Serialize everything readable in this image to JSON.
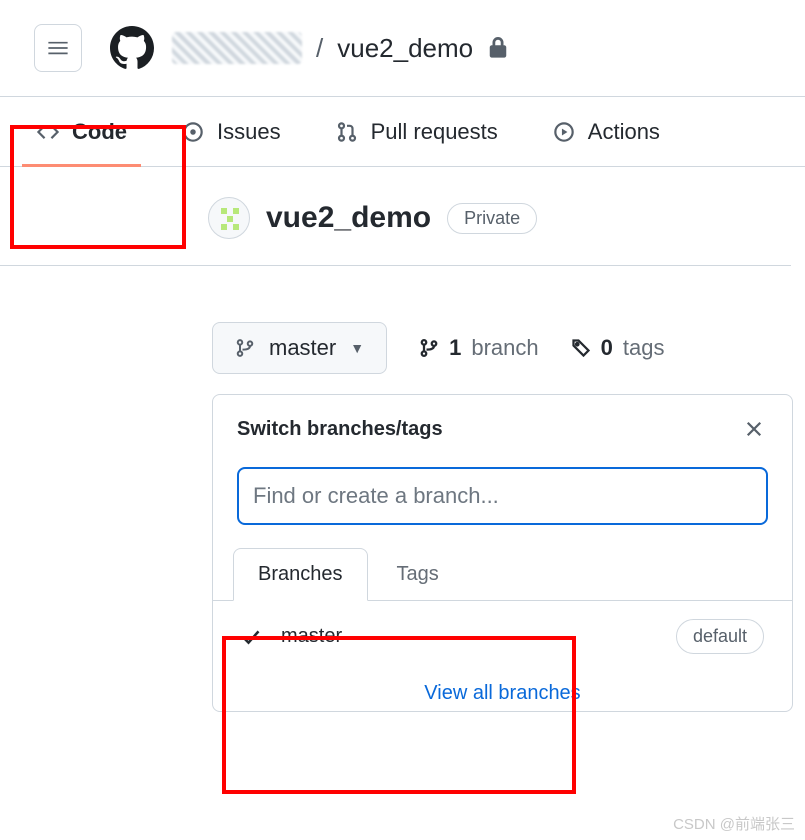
{
  "header": {
    "repo_name": "vue2_demo",
    "separator": "/"
  },
  "nav": {
    "code": "Code",
    "issues": "Issues",
    "pulls": "Pull requests",
    "actions": "Actions"
  },
  "repo": {
    "title": "vue2_demo",
    "visibility": "Private"
  },
  "branch_selector": {
    "current": "master",
    "branch_count": "1",
    "branch_label": "branch",
    "tag_count": "0",
    "tag_label": "tags"
  },
  "dropdown": {
    "title": "Switch branches/tags",
    "placeholder": "Find or create a branch...",
    "tab_branches": "Branches",
    "tab_tags": "Tags",
    "branch_list": {
      "item_name": "master",
      "default_label": "default"
    },
    "view_all": "View all branches"
  },
  "watermark": "CSDN @前端张三"
}
